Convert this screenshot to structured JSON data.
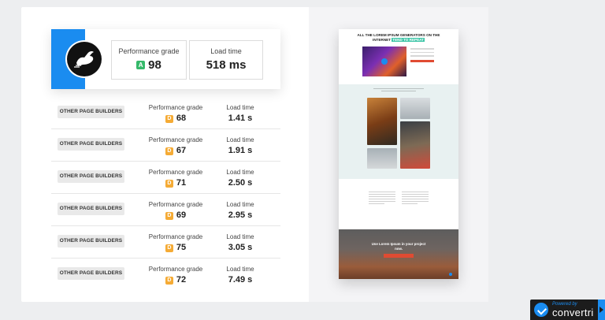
{
  "hero": {
    "logo_icon": "rabbit-icon",
    "performance_label": "Performance grade",
    "performance_grade": "A",
    "performance_score": "98",
    "load_label": "Load time",
    "load_value": "518 ms",
    "accent_color": "#1a8cf0"
  },
  "rows": [
    {
      "name": "OTHER PAGE BUILDERS",
      "perf_label": "Performance grade",
      "grade": "D",
      "score": "68",
      "load_label": "Load time",
      "load": "1.41 s"
    },
    {
      "name": "OTHER PAGE BUILDERS",
      "perf_label": "Performance grade",
      "grade": "D",
      "score": "67",
      "load_label": "Load time",
      "load": "1.91 s"
    },
    {
      "name": "OTHER PAGE BUILDERS",
      "perf_label": "Performance grade",
      "grade": "D",
      "score": "71",
      "load_label": "Load time",
      "load": "2.50 s"
    },
    {
      "name": "OTHER PAGE BUILDERS",
      "perf_label": "Performance grade",
      "grade": "D",
      "score": "69",
      "load_label": "Load time",
      "load": "2.95 s"
    },
    {
      "name": "OTHER PAGE BUILDERS",
      "perf_label": "Performance grade",
      "grade": "D",
      "score": "75",
      "load_label": "Load time",
      "load": "3.05 s"
    },
    {
      "name": "OTHER PAGE BUILDERS",
      "perf_label": "Performance grade",
      "grade": "D",
      "score": "72",
      "load_label": "Load time",
      "load": "7.49 s"
    }
  ],
  "preview": {
    "title_main": "ALL THE LOREM IPSUM GENERATORS ON THE INTERNET",
    "title_highlight": "TEND TO REPEAT",
    "footer_text": "Use Lorem Ipsum in your project now."
  },
  "powered": {
    "sub": "Powered by",
    "brand": "convertri",
    "icon": "check-circle-icon"
  }
}
